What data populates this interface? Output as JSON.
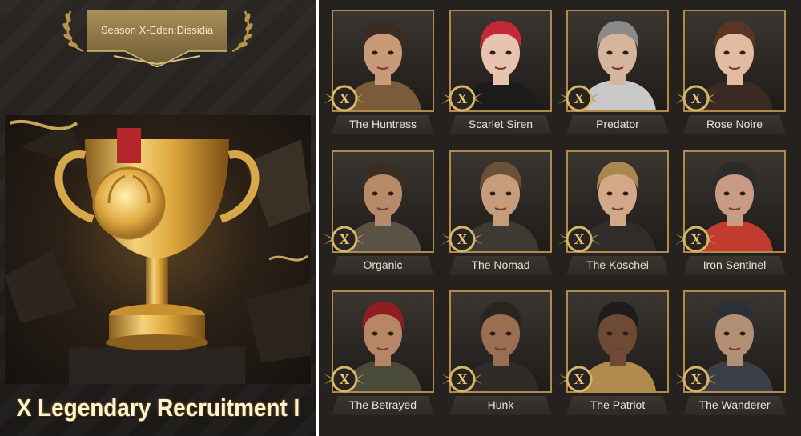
{
  "season_banner": {
    "label": "Season X-Eden:Dissidia"
  },
  "event_title": "X Legendary Recruitment I",
  "badge_letter": "X",
  "heroes": [
    {
      "name": "The Huntress",
      "hair": "#3a2a20",
      "skin": "#c99a78",
      "accent": "#7a5c3a"
    },
    {
      "name": "Scarlet Siren",
      "hair": "#c2283a",
      "skin": "#e8c4b0",
      "accent": "#1b1b1b"
    },
    {
      "name": "Predator",
      "hair": "#8a8a8a",
      "skin": "#d6b59c",
      "accent": "#c9c9c9"
    },
    {
      "name": "Rose Noire",
      "hair": "#5a3424",
      "skin": "#e2bca2",
      "accent": "#3a2a22"
    },
    {
      "name": "Organic",
      "hair": "#3a2e24",
      "skin": "#b58a68",
      "accent": "#5b5246"
    },
    {
      "name": "The Nomad",
      "hair": "#6b5136",
      "skin": "#c79c7a",
      "accent": "#3d3a33"
    },
    {
      "name": "The Koschei",
      "hair": "#a88850",
      "skin": "#d2a888",
      "accent": "#2f2c29"
    },
    {
      "name": "Iron Sentinel",
      "hair": "#2b2b2b",
      "skin": "#c99b84",
      "accent": "#c23b2e"
    },
    {
      "name": "The Betrayed",
      "hair": "#8e1e22",
      "skin": "#b88566",
      "accent": "#4a4a3a"
    },
    {
      "name": "Hunk",
      "hair": "#2a241e",
      "skin": "#9a6e52",
      "accent": "#2e2b28"
    },
    {
      "name": "The Patriot",
      "hair": "#1e1c1a",
      "skin": "#6e4a34",
      "accent": "#b08a4c"
    },
    {
      "name": "The Wanderer",
      "hair": "#2b3038",
      "skin": "#b38f76",
      "accent": "#3a3f47"
    }
  ]
}
